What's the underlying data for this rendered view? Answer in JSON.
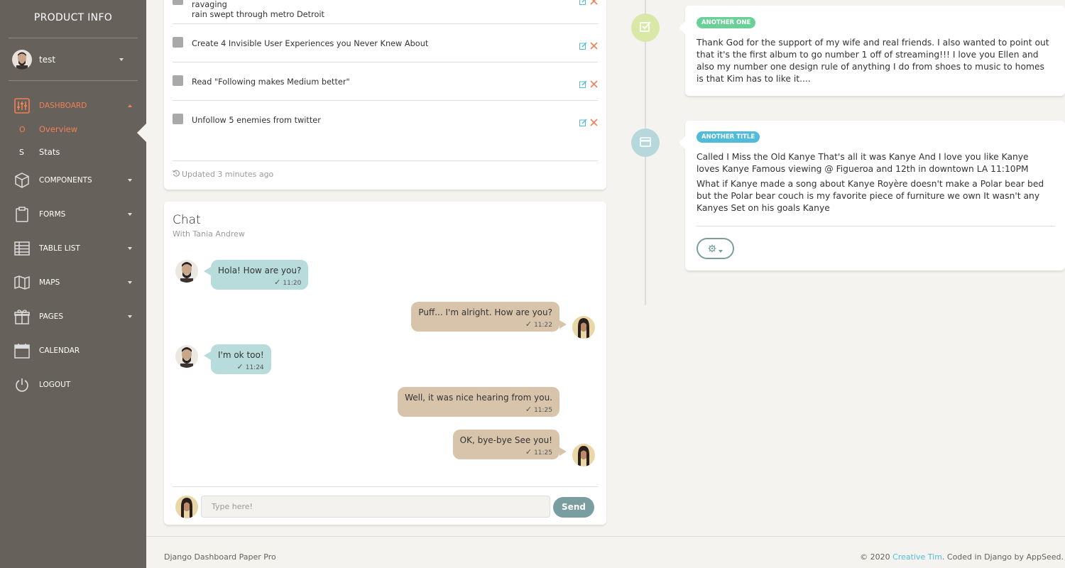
{
  "sidebar": {
    "brand": "PRODUCT INFO",
    "user_name": "test",
    "items": [
      {
        "label": "DASHBOARD",
        "icon": "sliders-icon"
      },
      {
        "label": "COMPONENTS",
        "icon": "box-icon"
      },
      {
        "label": "FORMS",
        "icon": "clipboard-icon"
      },
      {
        "label": "TABLE LIST",
        "icon": "table-icon"
      },
      {
        "label": "MAPS",
        "icon": "map-icon"
      },
      {
        "label": "PAGES",
        "icon": "gift-icon"
      },
      {
        "label": "CALENDAR",
        "icon": "calendar-icon"
      },
      {
        "label": "LOGOUT",
        "icon": "power-icon"
      }
    ],
    "sub_items": [
      {
        "mini": "O",
        "label": "Overview"
      },
      {
        "mini": "S",
        "label": "Stats"
      }
    ]
  },
  "tasks": {
    "items": [
      {
        "line1": "Flooded: One year later, assessing what was lost and what was found when a ravaging",
        "line2": "rain swept through metro Detroit"
      },
      {
        "line1": "Create 4 Invisible User Experiences you Never Knew About",
        "line2": ""
      },
      {
        "line1": "Read \"Following makes Medium better\"",
        "line2": ""
      },
      {
        "line1": "Unfollow 5 enemies from twitter",
        "line2": ""
      }
    ],
    "updated": "Updated 3 minutes ago"
  },
  "chat": {
    "title": "Chat",
    "subtitle": "With Tania Andrew",
    "messages": [
      {
        "text": "Hola! How are you?",
        "time": "11:20",
        "side": "left"
      },
      {
        "text": "Puff... I'm alright. How are you?",
        "time": "11:22",
        "side": "right"
      },
      {
        "text": "I'm ok too!",
        "time": "11:24",
        "side": "left"
      },
      {
        "text": "Well, it was nice hearing from you.",
        "time": "11:25",
        "side": "right"
      },
      {
        "text": "OK, bye-bye See you!",
        "time": "11:25",
        "side": "right"
      }
    ],
    "input_placeholder": "Type here!",
    "send_label": "Send"
  },
  "timeline": {
    "items": [
      {
        "label": "ANOTHER ONE",
        "label_color": "#6bd098",
        "badge_color": "#d9e8a6",
        "badge_icon": "check-square-icon",
        "paragraphs": [
          "Thank God for the support of my wife and real friends. I also wanted to point out that it's the first album to go number 1 off of streaming!!! I love you Ellen and also my number one design rule of anything I do from shoes to music to homes is that Kim has to like it...."
        ]
      },
      {
        "label": "ANOTHER TITLE",
        "label_color": "#51bcda",
        "badge_color": "#b6d8dd",
        "badge_icon": "credit-card-icon",
        "paragraphs": [
          "Called I Miss the Old Kanye That's all it was Kanye And I love you like Kanye loves Kanye Famous viewing @ Figueroa and 12th in downtown LA 11:10PM",
          "What if Kanye made a song about Kanye Royère doesn't make a Polar bear bed but the Polar bear couch is my favorite piece of furniture we own It wasn't any Kanyes Set on his goals Kanye"
        ]
      }
    ]
  },
  "footer": {
    "left": "Django Dashboard Paper Pro",
    "right_prefix": "© 2020",
    "right_link": "Creative Tim",
    "right_suffix": ". Coded in Django by AppSeed."
  },
  "colors": {
    "sidebar_bg": "#66615b",
    "accent": "#ef8157",
    "page_bg": "#f4f3ef",
    "send_button": "#7a9e9f"
  }
}
